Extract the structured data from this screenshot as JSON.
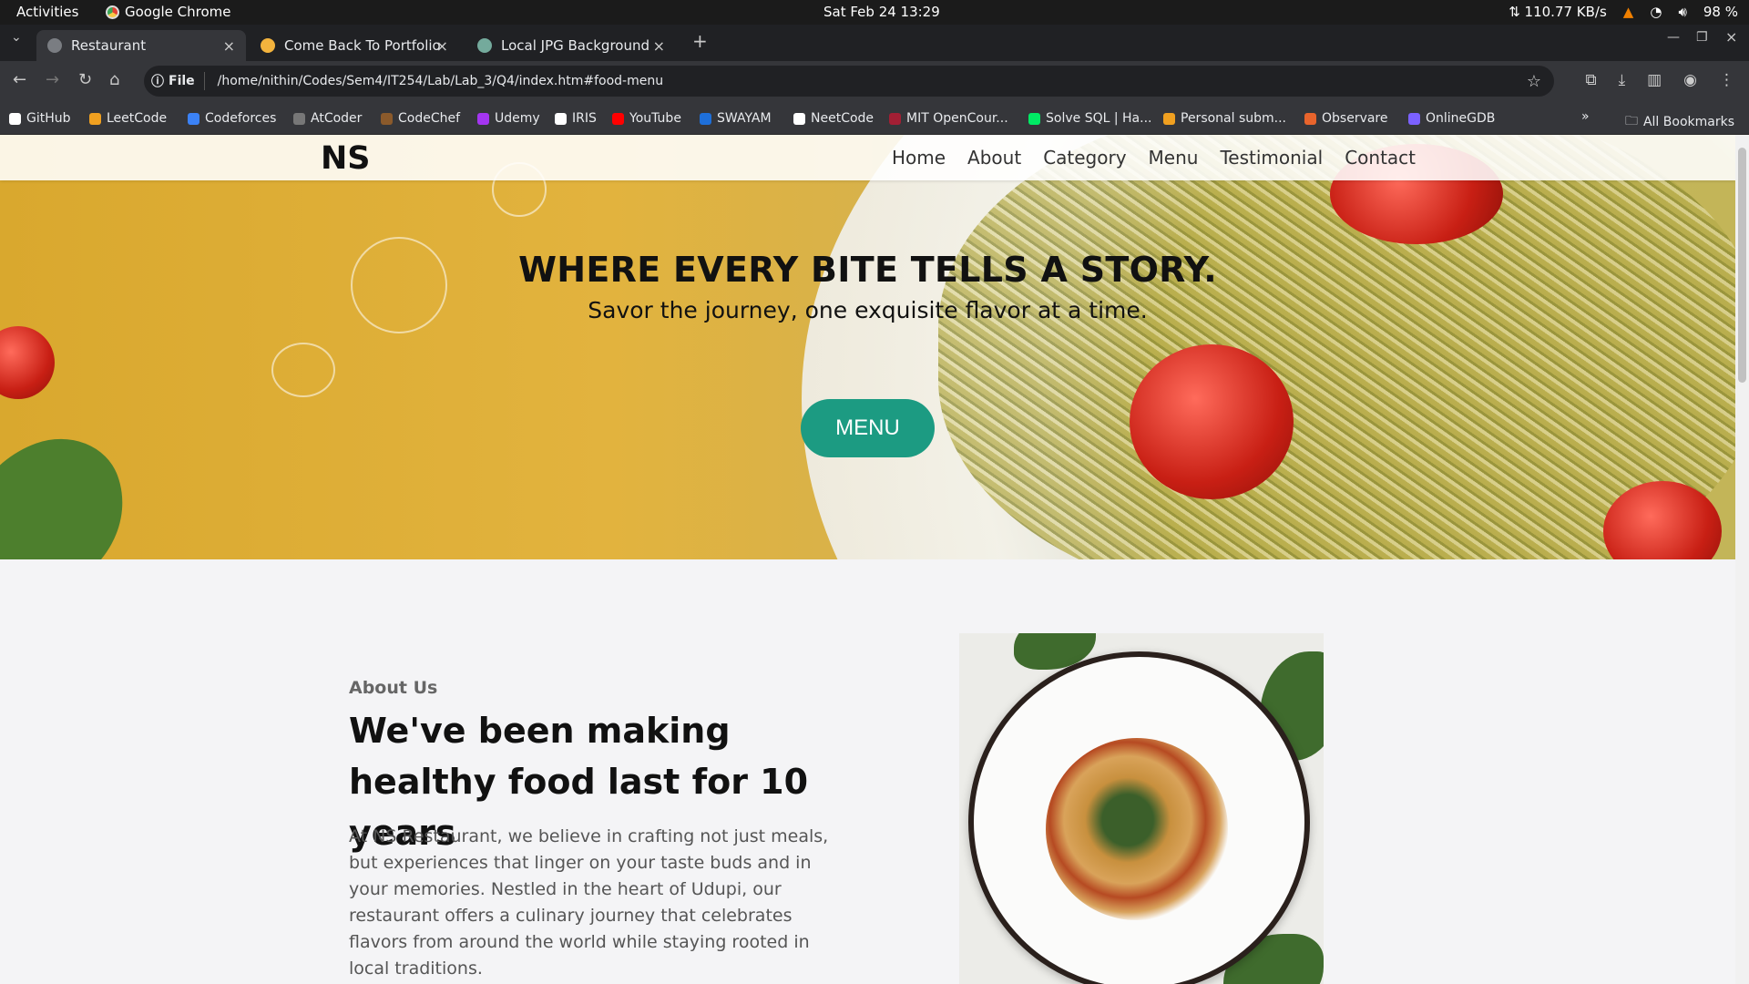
{
  "system_bar": {
    "activities": "Activities",
    "app_name": "Google Chrome",
    "clock": "Sat Feb 24  13:29",
    "net_speed": "⇅ 110.77 KB/s",
    "battery": "98 %"
  },
  "tabs": [
    {
      "title": "Restaurant",
      "active": true
    },
    {
      "title": "Come Back To Portfolio",
      "active": false
    },
    {
      "title": "Local JPG Background A",
      "active": false
    }
  ],
  "omnibox": {
    "scheme_label": "File",
    "url": "/home/nithin/Codes/Sem4/IT254/Lab/Lab_3/Q4/index.htm#food-menu"
  },
  "bookmarks": [
    {
      "label": "GitHub",
      "color": "#ffffff"
    },
    {
      "label": "LeetCode",
      "color": "#f0a020"
    },
    {
      "label": "Codeforces",
      "color": "#3b82f6"
    },
    {
      "label": "AtCoder",
      "color": "#777777"
    },
    {
      "label": "CodeChef",
      "color": "#8b5a2b"
    },
    {
      "label": "Udemy",
      "color": "#a435f0"
    },
    {
      "label": "IRIS",
      "color": "#ffffff"
    },
    {
      "label": "YouTube",
      "color": "#ff0000"
    },
    {
      "label": "SWAYAM",
      "color": "#1e6fd9"
    },
    {
      "label": "NeetCode",
      "color": "#ffffff"
    },
    {
      "label": "MIT OpenCour...",
      "color": "#a31f34"
    },
    {
      "label": "Solve SQL | Ha...",
      "color": "#00ea64"
    },
    {
      "label": "Personal subm...",
      "color": "#f0a020"
    },
    {
      "label": "Observare",
      "color": "#e8642c"
    },
    {
      "label": "OnlineGDB",
      "color": "#7b61ff"
    }
  ],
  "all_bookmarks": "All Bookmarks",
  "site": {
    "logo": "NS",
    "nav": [
      "Home",
      "About",
      "Category",
      "Menu",
      "Testimonial",
      "Contact"
    ],
    "hero_title": "WHERE EVERY BITE TELLS A STORY.",
    "hero_subtitle": "Savor the journey, one exquisite flavor at a time.",
    "hero_button": "MENU",
    "about_label": "About Us",
    "about_heading": "We've been making healthy food last for 10 years",
    "about_paragraph": "At NS Restaurant, we believe in crafting not just meals, but experiences that linger on your taste buds and in your memories. Nestled in the heart of Udupi, our restaurant offers a culinary journey that celebrates flavors from around the world while staying rooted in local traditions.",
    "accent_color": "#1c9b82"
  }
}
